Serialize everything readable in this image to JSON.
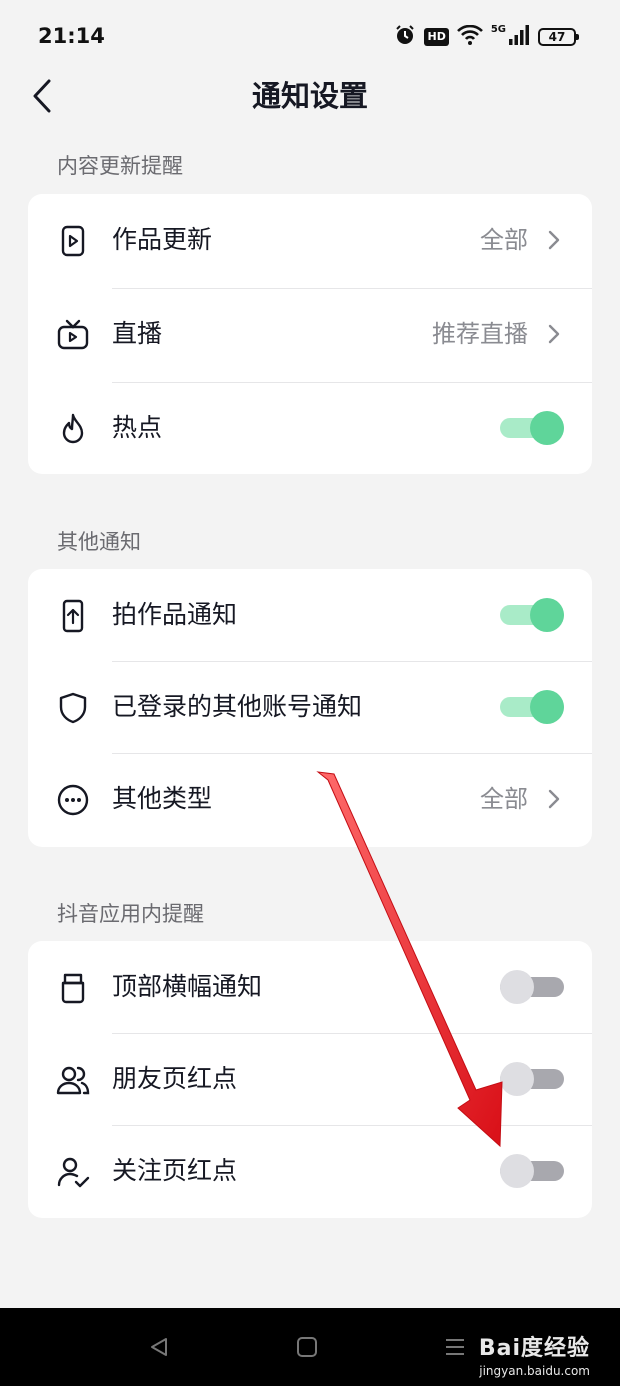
{
  "status_bar": {
    "time": "21:14",
    "network": "5G",
    "hd_badge": "HD",
    "battery": "47"
  },
  "header": {
    "title": "通知设置"
  },
  "sections": [
    {
      "title": "内容更新提醒",
      "items": [
        {
          "label": "作品更新",
          "icon": "video-play-icon",
          "control": "link",
          "value": "全部"
        },
        {
          "label": "直播",
          "icon": "live-tv-icon",
          "control": "link",
          "value": "推荐直播"
        },
        {
          "label": "热点",
          "icon": "flame-icon",
          "control": "toggle",
          "on": true
        }
      ]
    },
    {
      "title": "其他通知",
      "items": [
        {
          "label": "拍作品通知",
          "icon": "phone-upload-icon",
          "control": "toggle",
          "on": true
        },
        {
          "label": "已登录的其他账号通知",
          "icon": "shield-icon",
          "control": "toggle",
          "on": true
        },
        {
          "label": "其他类型",
          "icon": "more-circle-icon",
          "control": "link",
          "value": "全部"
        }
      ]
    },
    {
      "title": "抖音应用内提醒",
      "items": [
        {
          "label": "顶部横幅通知",
          "icon": "banner-icon",
          "control": "toggle",
          "on": false
        },
        {
          "label": "朋友页红点",
          "icon": "friends-icon",
          "control": "toggle",
          "on": false
        },
        {
          "label": "关注页红点",
          "icon": "user-check-icon",
          "control": "toggle",
          "on": false
        }
      ]
    }
  ],
  "watermark": {
    "logo": "Bai度经验",
    "url": "jingyan.baidu.com"
  },
  "colors": {
    "toggle_on": "#5fd59a",
    "toggle_off": "#dedee2",
    "annotation_arrow": "#e8121a"
  }
}
